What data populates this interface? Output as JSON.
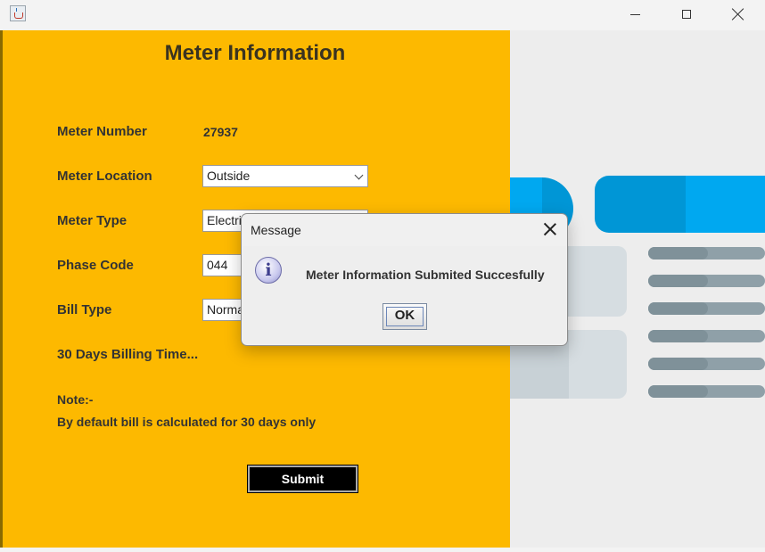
{
  "window": {
    "app_icon": "java-cup-icon"
  },
  "form": {
    "title": "Meter Information",
    "fields": [
      {
        "label": "Meter Number",
        "value": "27937"
      },
      {
        "label": "Meter Location",
        "value": "Outside"
      },
      {
        "label": "Meter Type",
        "value": "Electric Meter"
      },
      {
        "label": "Phase Code",
        "value": "044"
      },
      {
        "label": "Bill Type",
        "value": "Normal"
      }
    ],
    "billing_time_label": "30 Days Billing Time...",
    "note_title": "Note:-",
    "note_text": "By default bill is calculated for 30 days only",
    "submit_label": "Submit"
  },
  "dialog": {
    "title": "Message",
    "message": "Meter Information Submited Succesfully",
    "ok_label": "OK",
    "icon": "info-icon"
  },
  "colors": {
    "form_background": "#fdb900",
    "illustration_blue": "#00a8f0",
    "illustration_gray": "#8fa0a8"
  }
}
